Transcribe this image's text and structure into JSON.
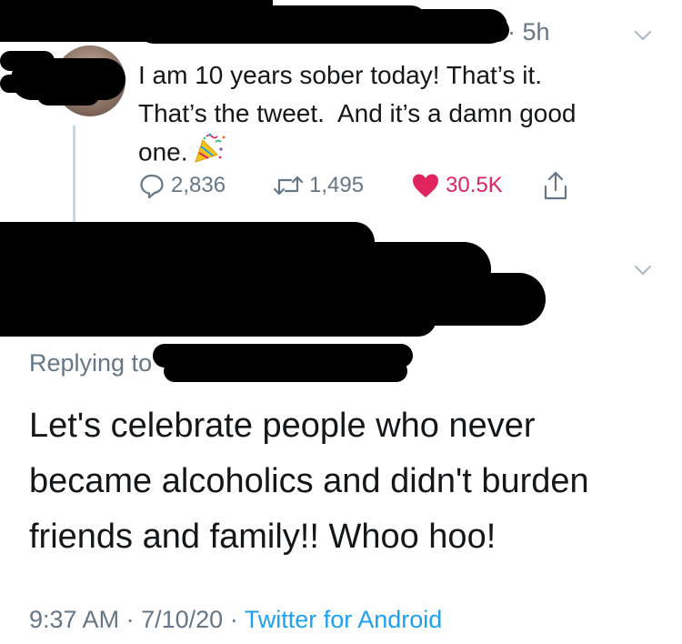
{
  "original_tweet": {
    "timestamp": "5h",
    "timestamp_prefix": "·",
    "text": "I am 10 years sober today! That’s it.\nThat’s the tweet.  And it’s a damn good\none.",
    "emoji_icon": "party-popper-icon",
    "actions": {
      "reply_count": "2,836",
      "retweet_count": "1,495",
      "like_count": "30.5K"
    },
    "colors": {
      "like": "#e0245e",
      "muted": "#657786",
      "thread_line": "#ccd6dd"
    }
  },
  "reply_tweet": {
    "replying_to": "Replying to",
    "text": "Let's celebrate people who never\nbecame alcoholics and didn't burden\nfriends and family!! Whoo hoo!",
    "time": "9:37 AM",
    "separator": "·",
    "date": "7/10/20",
    "source": "Twitter for Android",
    "colors": {
      "source_link": "#1da1f2"
    }
  }
}
